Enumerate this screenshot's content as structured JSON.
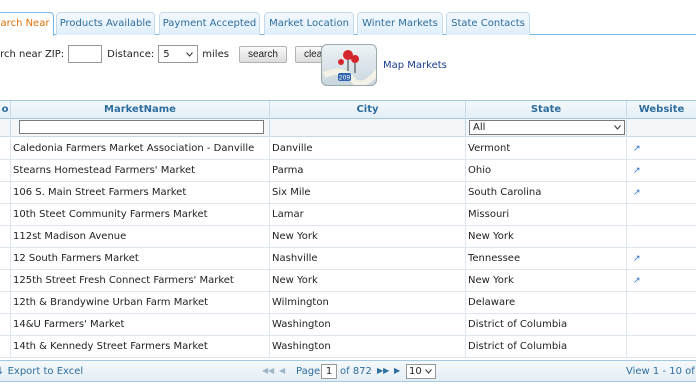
{
  "tabs": [
    {
      "label": "arch Near",
      "active": true
    },
    {
      "label": "Products Available"
    },
    {
      "label": "Payment Accepted"
    },
    {
      "label": "Market Location"
    },
    {
      "label": "Winter Markets"
    },
    {
      "label": "State Contacts"
    }
  ],
  "search": {
    "zip_label": "arch near ZIP:",
    "zip_value": "",
    "distance_label": "Distance:",
    "distance_value": "5",
    "miles_label": "miles",
    "search_button": "search",
    "clear_button": "clear"
  },
  "map": {
    "link": "Map Markets",
    "route_number": "209"
  },
  "grid": {
    "headers": {
      "col0": "o",
      "market": "MarketName",
      "city": "City",
      "state": "State",
      "website": "Website"
    },
    "state_filter": "All",
    "rows": [
      {
        "market": "Caledonia Farmers Market Association - Danville",
        "city": "Danville",
        "state": "Vermont",
        "website": true
      },
      {
        "market": "Stearns Homestead Farmers' Market",
        "city": "Parma",
        "state": "Ohio",
        "website": true
      },
      {
        "market": "106 S. Main Street Farmers Market",
        "city": "Six Mile",
        "state": "South Carolina",
        "website": true
      },
      {
        "market": "10th Steet Community Farmers Market",
        "city": "Lamar",
        "state": "Missouri",
        "website": false
      },
      {
        "market": "112st Madison Avenue",
        "city": "New York",
        "state": "New York",
        "website": false
      },
      {
        "market": "12 South Farmers Market",
        "city": "Nashville",
        "state": "Tennessee",
        "website": true
      },
      {
        "market": "125th Street Fresh Connect Farmers' Market",
        "city": "New York",
        "state": "New York",
        "website": true
      },
      {
        "market": "12th & Brandywine Urban Farm Market",
        "city": "Wilmington",
        "state": "Delaware",
        "website": false
      },
      {
        "market": "14&U Farmers' Market",
        "city": "Washington",
        "state": "District of Columbia",
        "website": false
      },
      {
        "market": "14th & Kennedy Street Farmers Market",
        "city": "Washington",
        "state": "District of Columbia",
        "website": false
      }
    ]
  },
  "pager": {
    "export": "Export to Excel",
    "page_label": "Page",
    "page_value": "1",
    "of_label": "of 872",
    "rows_per_page": "10",
    "view_info": "View 1 - 10 of 8"
  },
  "colors": {
    "tab_text": "#2e6e9e",
    "active_tab_text": "#e17009",
    "link": "#1a3d8f",
    "border": "#a6c9e2"
  }
}
